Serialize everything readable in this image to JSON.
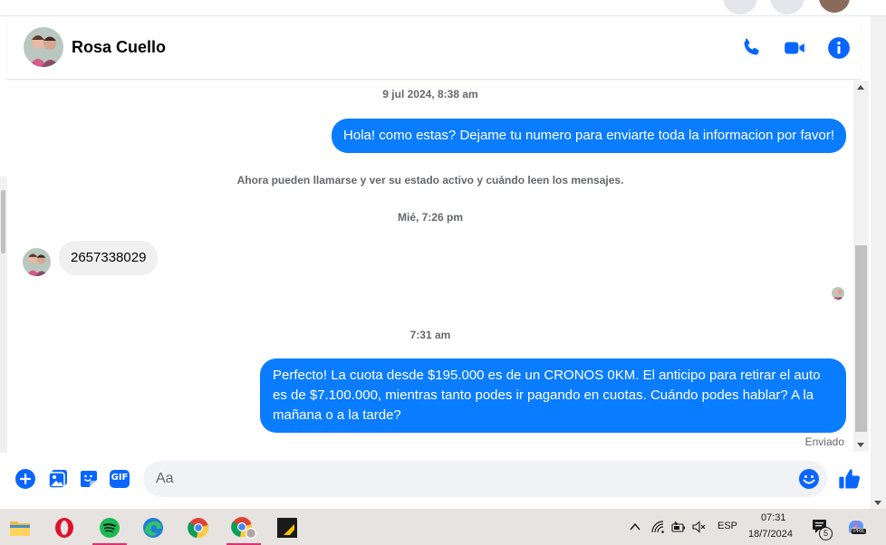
{
  "contact": {
    "name": "Rosa Cuello"
  },
  "header_icons": [
    "phone-icon",
    "video-camera-icon",
    "info-icon"
  ],
  "messages": {
    "timestamp_1": "9 jul 2024, 8:38 am",
    "out_1": "Hola! como estas? Dejame tu numero para enviarte toda la informacion por favor!",
    "system_notice": "Ahora pueden llamarse y ver su estado activo y cuándo leen los mensajes.",
    "timestamp_2": "Mié, 7:26 pm",
    "in_1": "2657338029",
    "timestamp_3": "7:31 am",
    "out_2": "Perfecto! La cuota desde $195.000 es de un CRONOS 0KM. El anticipo para retirar el auto es de $7.100.000, mientras tanto podes ir pagando en cuotas. Cuándo podes hablar? A la mañana o a la tarde?",
    "status": "Enviado"
  },
  "composer": {
    "placeholder": "Aa",
    "actions": [
      "plus-icon",
      "gallery-icon",
      "sticker-icon",
      "gif-icon",
      "emoji-icon",
      "thumbs-up-icon"
    ],
    "gif_label": "GIF"
  },
  "taskbar": {
    "apps": [
      "file-explorer-icon",
      "opera-icon",
      "spotify-icon",
      "edge-icon",
      "chrome-icon",
      "chrome-profile-icon",
      "sticky-app-icon"
    ],
    "language": "ESP",
    "time": "07:31",
    "date": "18/7/2024",
    "notification_count": "5",
    "copilot_badge": "PRE"
  },
  "colors": {
    "accent": "#0a7cff",
    "icon_blue": "#0866ff",
    "incoming_bubble": "#f0f0f0",
    "muted_text": "#65676b",
    "taskbar": "#e7e3e1"
  }
}
